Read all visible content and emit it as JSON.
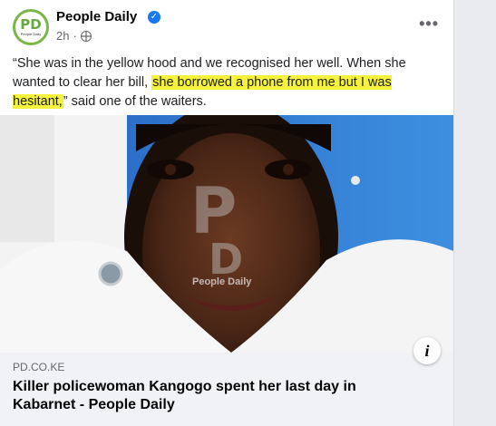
{
  "post": {
    "page_name": "People Daily",
    "time": "2h",
    "avatar_logo": "PD",
    "avatar_sub": "People Daily",
    "text_part1": "“She was in the yellow hood and we recognised her well. When she wanted to clear her bill, ",
    "text_highlight": "she borrowed a phone from me but I was hesitant,",
    "text_part2": "” said one of the waiters."
  },
  "photo": {
    "watermark_logo": "PD",
    "watermark_text": "People Daily"
  },
  "link_preview": {
    "domain": "PD.CO.KE",
    "title": "Killer policewoman Kangogo spent her last day in Kabarnet - People Daily"
  },
  "icons": {
    "verified": "verified-badge-icon",
    "privacy": "globe-icon",
    "more": "more-options-icon",
    "info": "info-icon"
  },
  "colors": {
    "highlight": "#f4f23a",
    "brand_green": "#7ab648",
    "verified_blue": "#1877f2"
  }
}
